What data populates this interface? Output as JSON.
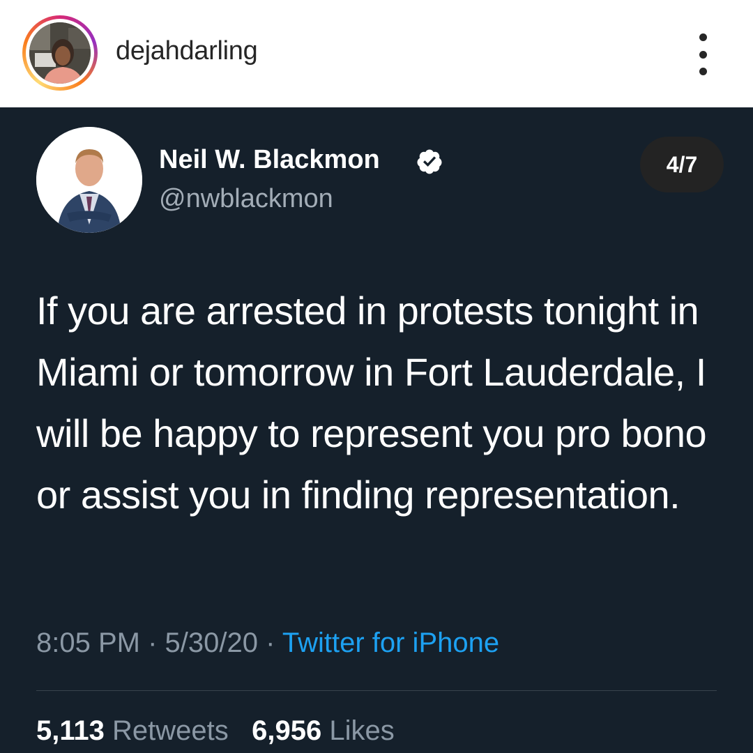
{
  "instagram": {
    "username": "dejahdarling",
    "avatar_icon": "profile-photo",
    "more_icon": "more-vertical-icon",
    "ring_colors": [
      "#d62976",
      "#962fbf",
      "#fa7e1e",
      "#feda75"
    ]
  },
  "tweet": {
    "author_name": "Neil W. Blackmon",
    "verified_icon": "verified-badge-icon",
    "handle": "@nwblackmon",
    "counter": "4/7",
    "body": "If you are arrested in protests tonight in Miami or tomorrow in Fort Lauderdale, I will be happy to represent you pro bono or assist you in finding representation.",
    "time": "8:05 PM",
    "date": "5/30/20",
    "separator": "·",
    "source": "Twitter for iPhone",
    "retweets_count": "5,113",
    "retweets_label": "Retweets",
    "likes_count": "6,956",
    "likes_label": "Likes",
    "background_color": "#15202b",
    "link_color": "#1da1f2"
  }
}
